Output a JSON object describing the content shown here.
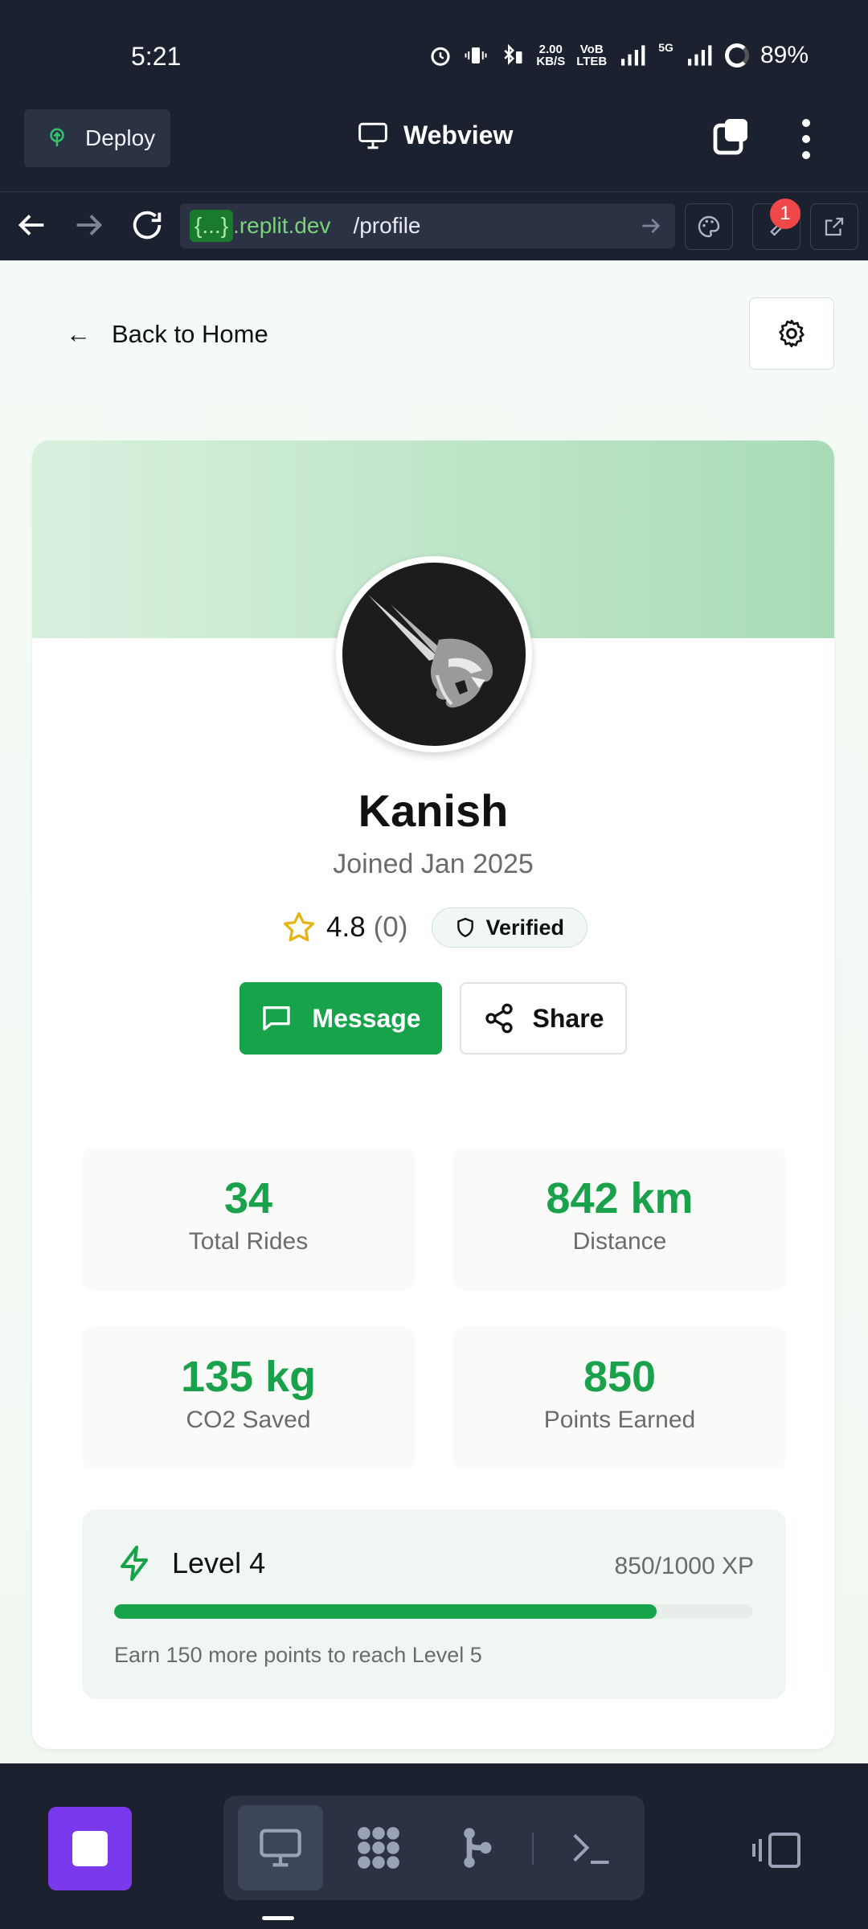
{
  "status_bar": {
    "time": "5:21",
    "net_speed_top": "2.00",
    "net_speed_unit": "KB/S",
    "volte_top": "VoB",
    "volte_bottom": "LTEB",
    "signal_label": "5G",
    "battery": "89%"
  },
  "replit": {
    "deploy_label": "Deploy",
    "webview_title": "Webview",
    "url_badge": "{...}",
    "url_host": ".replit.dev",
    "url_path": "/profile",
    "notification_count": "1"
  },
  "page": {
    "back_label": "Back to Home",
    "back_arrow": "←",
    "profile": {
      "name": "Kanish",
      "joined": "Joined Jan 2025",
      "rating": "4.8",
      "rating_count": "(0)",
      "verified_label": "Verified"
    },
    "actions": {
      "message_label": "Message",
      "share_label": "Share"
    },
    "stats": [
      {
        "value": "34",
        "label": "Total Rides"
      },
      {
        "value": "842 km",
        "label": "Distance"
      },
      {
        "value": "135 kg",
        "label": "CO2 Saved"
      },
      {
        "value": "850",
        "label": "Points Earned"
      }
    ],
    "level": {
      "title": "Level 4",
      "xp": "850/1000 XP",
      "progress": 0.85,
      "note": "Earn 150 more points to reach Level 5"
    }
  },
  "colors": {
    "accent": "#17a34a",
    "banner_start": "#d8f0de",
    "banner_end": "#a8dcb6",
    "star": "#e7b416",
    "stop": "#7b39ed"
  }
}
